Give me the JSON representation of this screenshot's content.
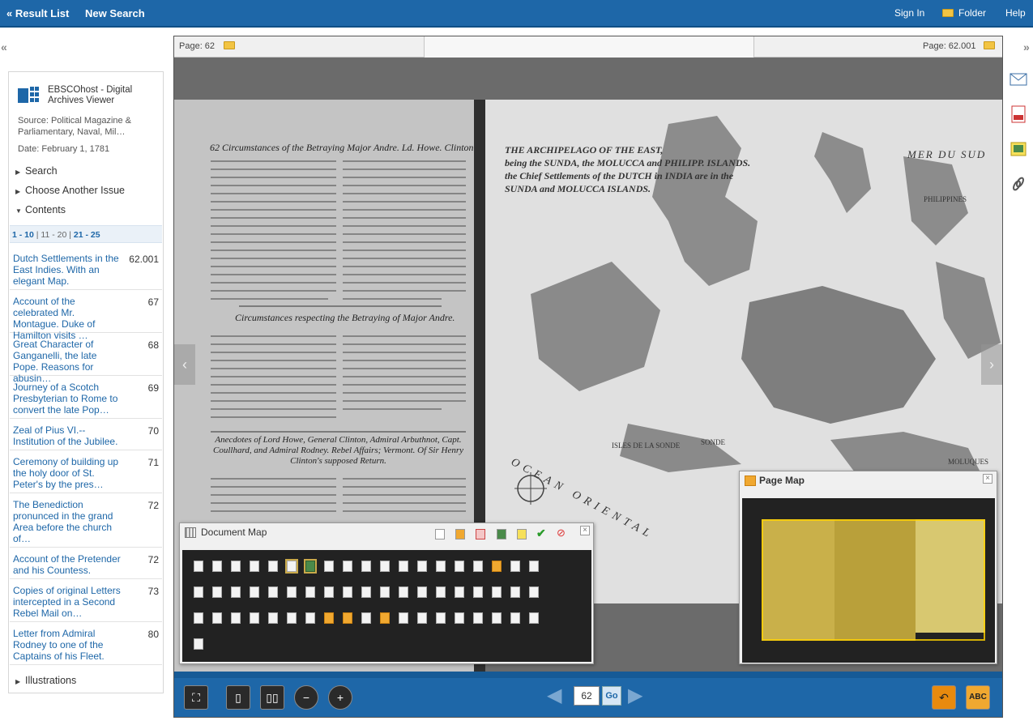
{
  "topbar": {
    "result_list": "« Result List",
    "new_search": "New Search",
    "sign_in": "Sign In",
    "folder": "Folder",
    "help": "Help"
  },
  "sidebar": {
    "app_title": "EBSCOhost - Digital Archives Viewer",
    "source": "Source: Political Magazine & Parliamentary, Naval, Mil…",
    "date": "Date: February 1, 1781",
    "search": "Search",
    "choose_issue": "Choose Another Issue",
    "contents": "Contents",
    "pager": [
      "1 - 10",
      "11 - 20",
      "21 - 25"
    ],
    "toc": [
      {
        "title": "Dutch Settlements in the East Indies. With an elegant Map.",
        "page": "62.001"
      },
      {
        "title": "Account of the celebrated Mr. Montague. Duke of Hamilton visits …",
        "page": "67"
      },
      {
        "title": "Great Character of Ganganelli, the late Pope. Reasons for abusin…",
        "page": "68"
      },
      {
        "title": "Journey of a Scotch Presbyterian to Rome to convert the late Pop…",
        "page": "69"
      },
      {
        "title": "Zeal of Pius VI.--Institution of the Jubilee.",
        "page": "70"
      },
      {
        "title": "Ceremony of building up the holy door of St. Peter's by the pres…",
        "page": "71"
      },
      {
        "title": "The Benediction pronunced in the grand Area before the church of…",
        "page": "72"
      },
      {
        "title": "Account of the Pretender and his Countess.",
        "page": "72"
      },
      {
        "title": "Copies of original Letters intercepted in a Second Rebel Mail on…",
        "page": "73"
      },
      {
        "title": "Letter from Admiral Rodney to one of the Captains of his Fleet.",
        "page": "80"
      }
    ],
    "illustrations": "Illustrations"
  },
  "viewer": {
    "left_page": "Page: 62",
    "right_page": "Page: 62.001",
    "left_heading": "62 Circumstances of the Betraying Major Andre. Ld. Howe. Clinton.",
    "left_section": "Circumstances respecting the Betraying of Major Andre.",
    "left_section2": "Anecdotes of Lord Howe, General Clinton, Admiral Arbuthnot, Capt. Coullhard, and Admiral Rodney. Rebel Affairs; Vermont. Of Sir Henry Clinton's supposed Return.",
    "map_title1": "THE ARCHIPELAGO OF THE EAST,",
    "map_title2": "being the SUNDA, the MOLUCCA and PHILIPP. ISLANDS.",
    "map_title3": "the Chief Settlements of the DUTCH in INDIA are in the",
    "map_title4": "SUNDA and MOLUCCA ISLANDS.",
    "map_labels": [
      "MER DU SUD",
      "PHILIPPINES",
      "MOLUQUES",
      "OCEAN ORIENTAL",
      "ISLES DE LA SONDE",
      "SONDE"
    ]
  },
  "document_map": {
    "title": "Document Map"
  },
  "page_map": {
    "title": "Page Map"
  },
  "bottombar": {
    "page_value": "62",
    "go": "Go",
    "spell": "ABC"
  }
}
